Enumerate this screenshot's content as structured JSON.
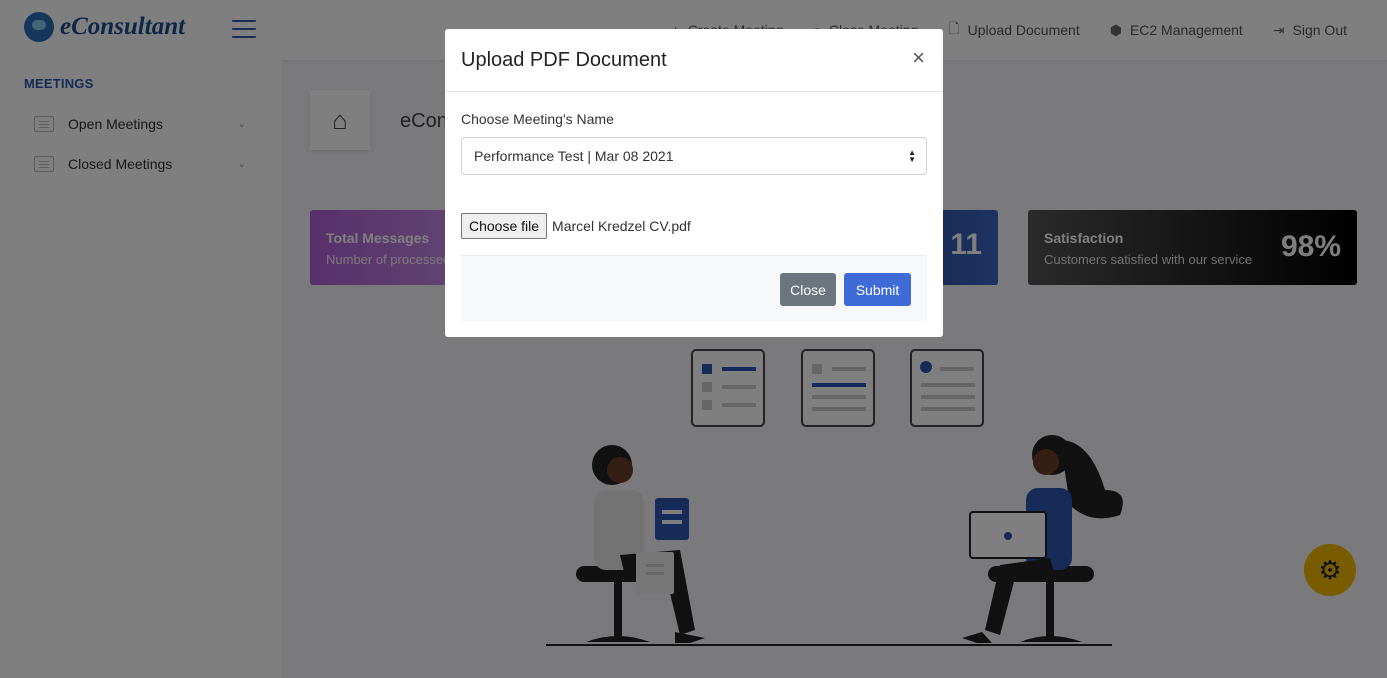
{
  "brand": {
    "name": "eConsultant"
  },
  "nav": {
    "links": [
      {
        "label": "Create Meeting",
        "icon": "plus-icon"
      },
      {
        "label": "Close Meeting",
        "icon": "lock-icon"
      },
      {
        "label": "Upload Document",
        "icon": "document-icon"
      },
      {
        "label": "EC2 Management",
        "icon": "cube-icon"
      },
      {
        "label": "Sign Out",
        "icon": "sign-out-icon"
      }
    ]
  },
  "sidebar": {
    "heading": "MEETINGS",
    "items": [
      {
        "label": "Open Meetings"
      },
      {
        "label": "Closed Meetings"
      }
    ]
  },
  "main": {
    "title": "eConsultant",
    "cards": {
      "total": {
        "title": "Total Messages",
        "subtitle": "Number of processed messages"
      },
      "mid": {
        "value": "11"
      },
      "satisfaction": {
        "title": "Satisfaction",
        "subtitle": "Customers satisfied with our service",
        "value": "98%"
      }
    }
  },
  "modal": {
    "title": "Upload PDF Document",
    "close_symbol": "×",
    "meeting_label": "Choose Meeting's Name",
    "meeting_selected": "Performance Test | Mar 08 2021",
    "file_button": "Choose file",
    "file_name": "Marcel Kredzel CV.pdf",
    "close_button": "Close",
    "submit_button": "Submit"
  },
  "colors": {
    "primary": "#3e6bd6",
    "secondary": "#6c757d",
    "brand": "#1f4f8f",
    "settings_button": "#f2b705"
  }
}
